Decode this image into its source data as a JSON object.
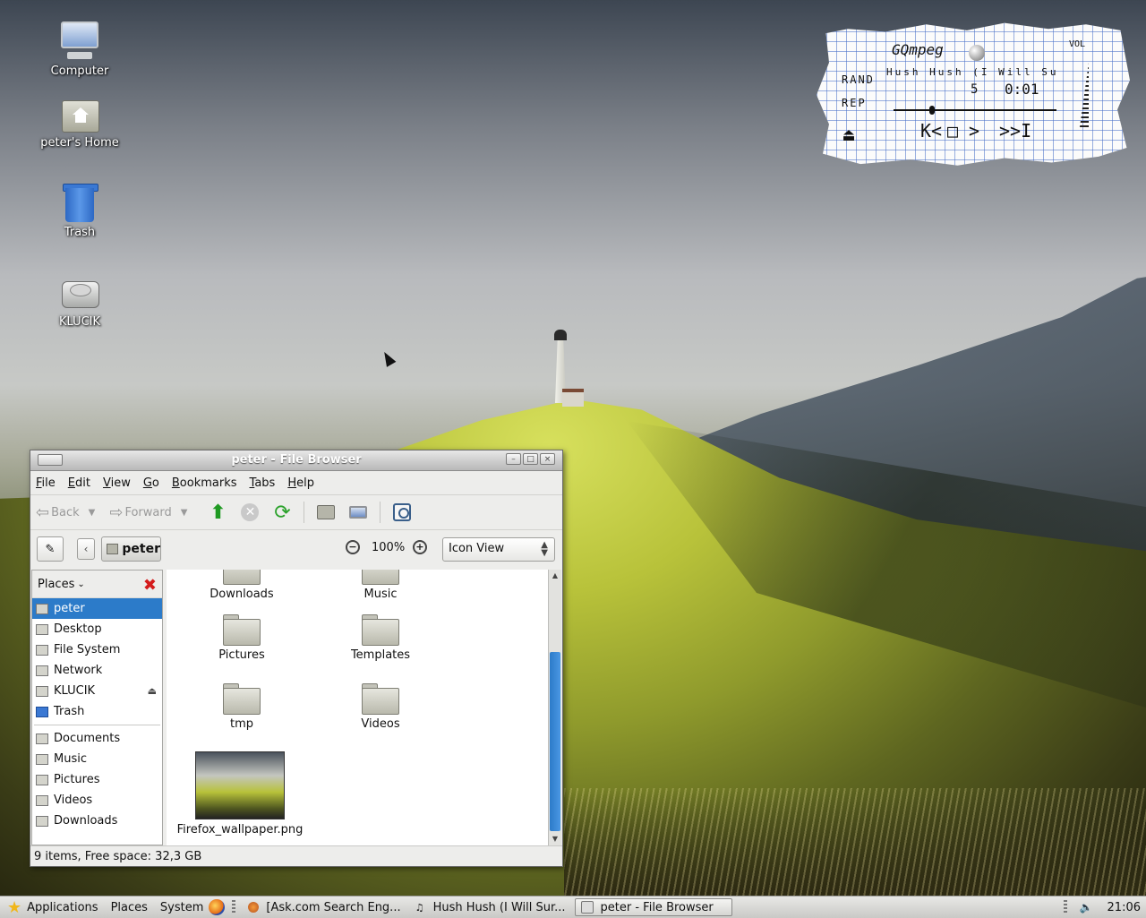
{
  "desktop": {
    "icons": [
      {
        "label": "Computer"
      },
      {
        "label": "peter's Home"
      },
      {
        "label": "Trash"
      },
      {
        "label": "KLUCIK"
      }
    ]
  },
  "gqmpeg": {
    "title": "GQmpeg",
    "vol_label": "VOL",
    "rand_label": "RAND",
    "rep_label": "REP",
    "song": "Hush Hush (I Will Su",
    "track": "5",
    "time": "0:01",
    "buttons": {
      "eject": "⏏",
      "prev": "K<",
      "stop": "□",
      "play": ">",
      "next": ">>I"
    }
  },
  "window": {
    "title": "peter - File Browser",
    "menu": [
      "File",
      "Edit",
      "View",
      "Go",
      "Bookmarks",
      "Tabs",
      "Help"
    ],
    "toolbar": {
      "back": "Back",
      "forward": "Forward"
    },
    "location": {
      "crumb": "peter",
      "zoom": "100%",
      "view_mode": "Icon View"
    },
    "sidebar": {
      "header": "Places",
      "places": [
        {
          "label": "peter",
          "selected": true
        },
        {
          "label": "Desktop"
        },
        {
          "label": "File System"
        },
        {
          "label": "Network"
        },
        {
          "label": "KLUCIK"
        },
        {
          "label": "Trash"
        }
      ],
      "bookmarks": [
        "Documents",
        "Music",
        "Pictures",
        "Videos",
        "Downloads"
      ]
    },
    "files": [
      {
        "name": "Downloads"
      },
      {
        "name": "Music"
      },
      {
        "name": "Pictures"
      },
      {
        "name": "Templates"
      },
      {
        "name": "tmp"
      },
      {
        "name": "Videos"
      },
      {
        "name": "Firefox_wallpaper.png"
      }
    ],
    "status": "9 items, Free space: 32,3 GB"
  },
  "panel": {
    "applications": "Applications",
    "places": "Places",
    "system": "System",
    "tasks": [
      {
        "label": "[Ask.com Search Eng..."
      },
      {
        "label": "Hush Hush (I Will Sur..."
      },
      {
        "label": "peter - File Browser",
        "active": true
      }
    ],
    "clock": "21:06"
  }
}
